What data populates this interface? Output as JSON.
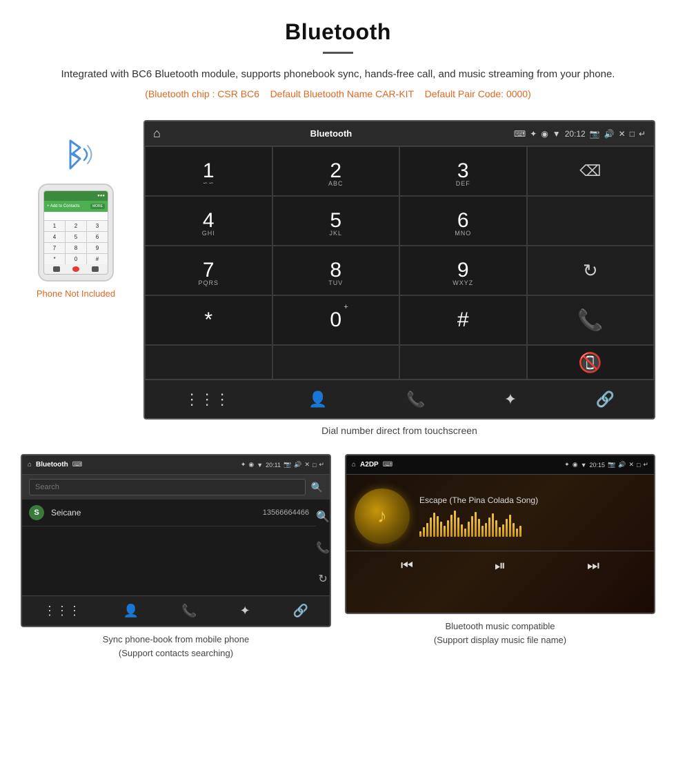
{
  "header": {
    "title": "Bluetooth",
    "description": "Integrated with BC6 Bluetooth module, supports phonebook sync, hands-free call, and music streaming from your phone.",
    "specs": "(Bluetooth chip : CSR BC6    Default Bluetooth Name CAR-KIT    Default Pair Code: 0000)",
    "specs_parts": {
      "part1": "(Bluetooth chip : CSR BC6",
      "part2": "Default Bluetooth Name CAR-KIT",
      "part3": "Default Pair Code: 0000)"
    }
  },
  "phone_graphic": {
    "not_included_label": "Phone Not Included"
  },
  "car_screen_dial": {
    "status_bar": {
      "title": "Bluetooth",
      "usb_icon": "⌨",
      "time": "20:12",
      "icons": "✦ ◉ ▼ ◷ 🔋 ⊡ 🔊 ✕ □ ↵"
    },
    "dial_keys": [
      {
        "num": "1",
        "sub": "∽∽"
      },
      {
        "num": "2",
        "sub": "ABC"
      },
      {
        "num": "3",
        "sub": "DEF"
      },
      {
        "num": "",
        "sub": "",
        "type": "empty"
      },
      {
        "num": "4",
        "sub": "GHI"
      },
      {
        "num": "5",
        "sub": "JKL"
      },
      {
        "num": "6",
        "sub": "MNO"
      },
      {
        "num": "",
        "sub": "",
        "type": "empty"
      },
      {
        "num": "7",
        "sub": "PQRS"
      },
      {
        "num": "8",
        "sub": "TUV"
      },
      {
        "num": "9",
        "sub": "WXYZ"
      },
      {
        "num": "",
        "sub": "",
        "type": "refresh"
      },
      {
        "num": "*",
        "sub": ""
      },
      {
        "num": "0",
        "sub": "+",
        "type": "zero"
      },
      {
        "num": "#",
        "sub": ""
      },
      {
        "num": "",
        "sub": "",
        "type": "call-green"
      },
      {
        "num": "",
        "sub": "",
        "type": "empty"
      },
      {
        "num": "",
        "sub": "",
        "type": "empty"
      },
      {
        "num": "",
        "sub": "",
        "type": "empty"
      },
      {
        "num": "",
        "sub": "",
        "type": "call-red"
      }
    ],
    "bottom_icons": [
      "⋮⋮⋮",
      "👤",
      "📞",
      "✦",
      "🔗"
    ],
    "caption": "Dial number direct from touchscreen"
  },
  "phonebook_screen": {
    "status_bar": {
      "home_icon": "⌂",
      "title": "Bluetooth",
      "usb_icon": "⌨",
      "time": "20:11",
      "right_icons": "✦ ◉ ▼"
    },
    "search_placeholder": "Search",
    "contacts": [
      {
        "letter": "S",
        "name": "Seicane",
        "number": "13566664466"
      }
    ],
    "side_icons": [
      "🔍",
      "📞",
      "🔄"
    ],
    "bottom_icons": [
      "⋮⋮⋮",
      "👤",
      "📞",
      "✦",
      "🔗"
    ],
    "caption_line1": "Sync phone-book from mobile phone",
    "caption_line2": "(Support contacts searching)"
  },
  "music_screen": {
    "status_bar": {
      "home_icon": "⌂",
      "title": "A2DP",
      "usb_icon": "⌨",
      "time": "20:15",
      "right_icons": "✦ ◉ ▼"
    },
    "song_title": "Escape (The Pina Colada Song)",
    "wave_heights": [
      8,
      14,
      20,
      28,
      35,
      30,
      22,
      16,
      24,
      32,
      38,
      28,
      18,
      12,
      22,
      30,
      36,
      26,
      16,
      20,
      28,
      34,
      24,
      14,
      18,
      26,
      32,
      20,
      12,
      16
    ],
    "controls": [
      "⏮",
      "⏯",
      "⏭"
    ],
    "caption_line1": "Bluetooth music compatible",
    "caption_line2": "(Support display music file name)"
  }
}
